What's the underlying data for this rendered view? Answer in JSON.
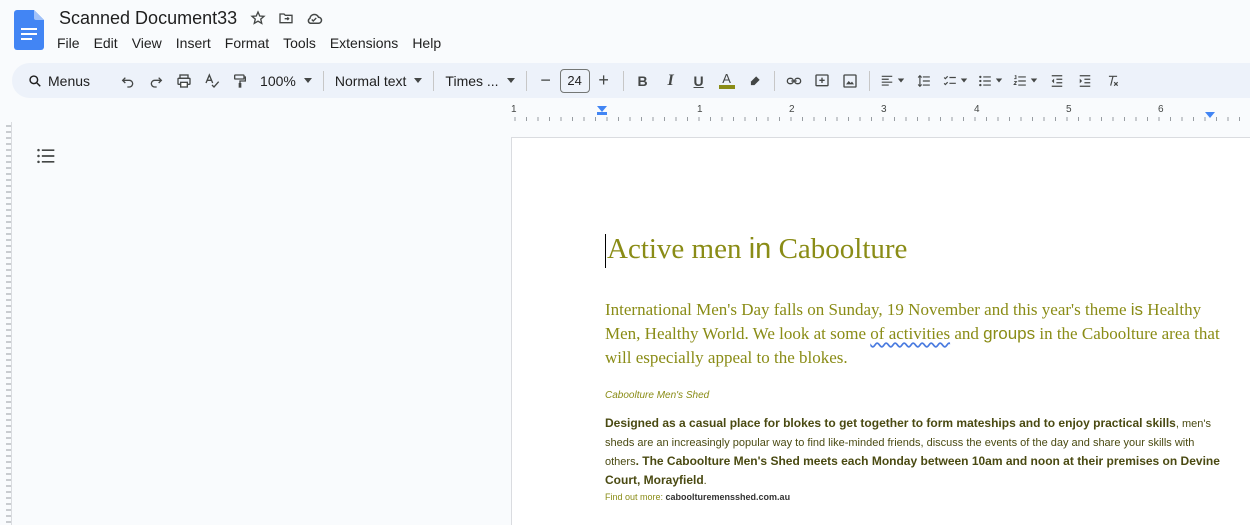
{
  "app": {
    "doc_title": "Scanned Document33",
    "menu": [
      "File",
      "Edit",
      "View",
      "Insert",
      "Format",
      "Tools",
      "Extensions",
      "Help"
    ]
  },
  "toolbar": {
    "search_label": "Menus",
    "zoom": "100%",
    "style": "Normal text",
    "font": "Times ...",
    "font_size": "24",
    "bold": "B",
    "italic": "I",
    "underline": "U",
    "text_color_letter": "A",
    "minus": "−",
    "plus": "+"
  },
  "ruler": {
    "numbers": [
      "1",
      "1",
      "2",
      "3",
      "4",
      "5",
      "6"
    ]
  },
  "document": {
    "heading_part1": "Active men ",
    "heading_part2": "in",
    "heading_part3": " Caboolture",
    "intro_part1": "International Men's Day falls on Sunday, 19 November and this year's theme ",
    "intro_is": "is",
    "intro_part2": " Healthy Men, Healthy World. We look at some ",
    "intro_spell": "of activities",
    "intro_part3": " and ",
    "intro_groups": "groups",
    "intro_part4": " in the Caboolture area that will especially appeal to the blokes.",
    "subhead": "Caboolture Men's Shed",
    "body_part1": "Designed as a  casual place for blokes to get together to form mateships and to enjoy practical skills",
    "body_part2": ", men's sheds are an increasingly popular way to find like-minded friends, discuss the events of the day and share your skills with others",
    "body_part3": ". The Caboolture Men's Shed meets each Monday between 10am and noon at their premises on Devine Court, Morayfield",
    "body_part4": ".",
    "findout_label": "Find out more: ",
    "findout_link": "caboolturemensshed.com.au"
  },
  "colors": {
    "heading": "#8a8c16",
    "doc_blue": "#4285f4",
    "toolbar_bg": "#edf2fa"
  }
}
